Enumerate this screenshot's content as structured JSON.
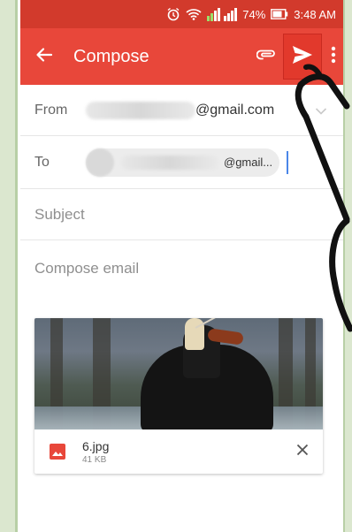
{
  "status_bar": {
    "battery": "74%",
    "time": "3:48 AM",
    "icons": [
      "alarm-icon",
      "wifi-icon",
      "signal-icon",
      "battery-icon"
    ]
  },
  "app_bar": {
    "title": "Compose",
    "actions": [
      "back-arrow-icon",
      "attach-icon",
      "send-icon",
      "more-vert-icon"
    ]
  },
  "compose": {
    "from": {
      "label": "From",
      "value_suffix": "@gmail.com"
    },
    "to": {
      "label": "To",
      "recipient_suffix": "@gmail..."
    },
    "subject": {
      "placeholder": "Subject"
    },
    "body": {
      "placeholder": "Compose email"
    }
  },
  "attachment": {
    "file_name": "6.jpg",
    "file_size": "41 KB"
  },
  "colors": {
    "status_bar": "#d23a2c",
    "app_bar": "#e8473a",
    "cursor": "#4a86e8",
    "file_icon": "#e8473a"
  }
}
